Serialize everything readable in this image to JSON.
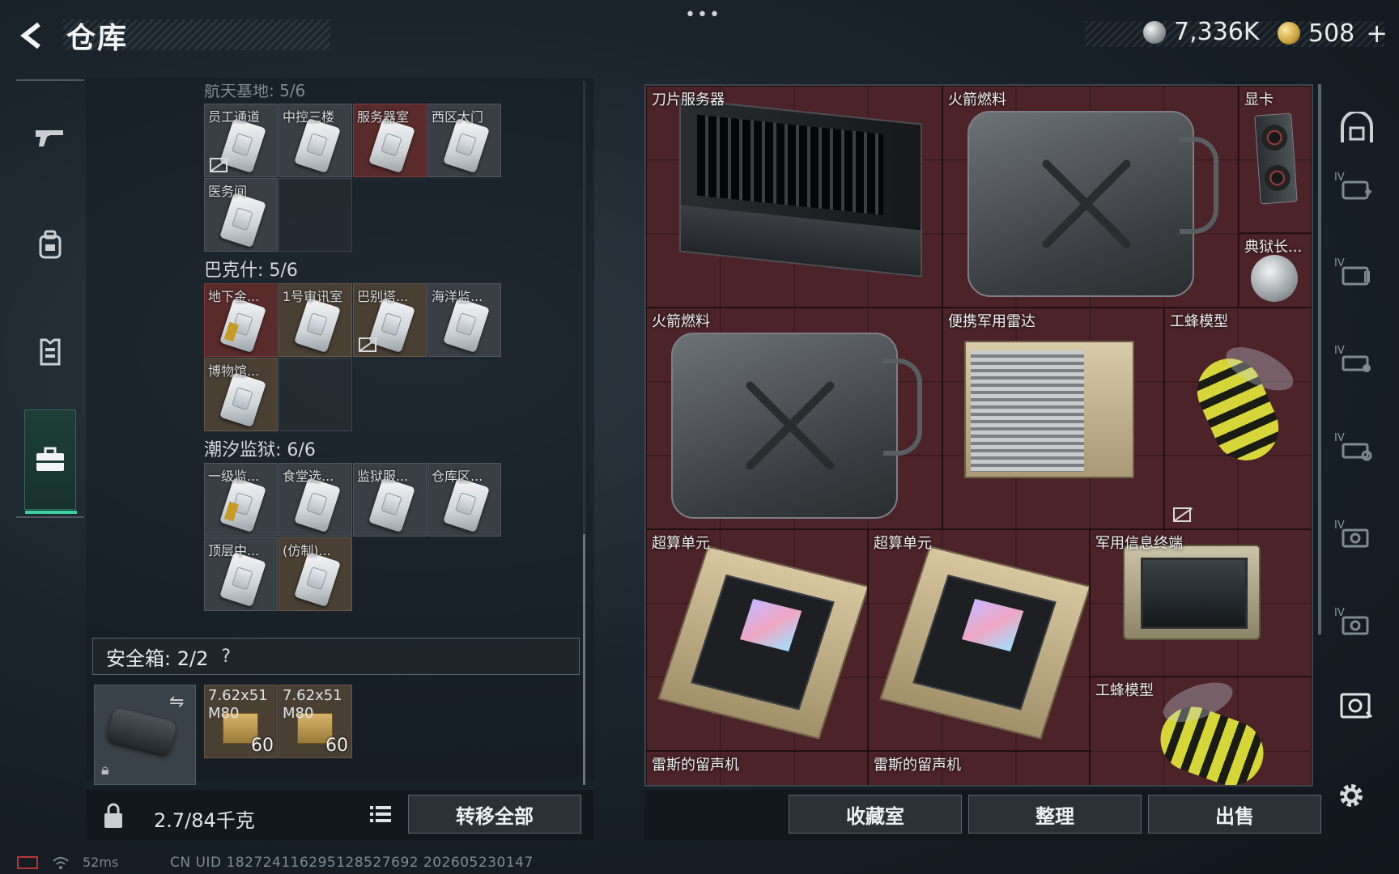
{
  "header": {
    "title": "仓库",
    "currency": [
      {
        "icon": "silver-coin-icon",
        "amount": "7,336K"
      },
      {
        "icon": "gold-coin-icon",
        "amount": "508",
        "add": "+"
      }
    ]
  },
  "left_tabs": [
    {
      "icon": "gun-icon"
    },
    {
      "icon": "backpack-icon"
    },
    {
      "icon": "vest-icon"
    },
    {
      "icon": "briefcase-icon",
      "active": true
    }
  ],
  "key_groups": [
    {
      "title": "航天基地: 5/6",
      "cards": [
        {
          "label": "员工通道",
          "tone": "grey",
          "locked": true
        },
        {
          "label": "中控三楼",
          "tone": "grey"
        },
        {
          "label": "服务器室",
          "tone": "red"
        },
        {
          "label": "西区大门",
          "tone": "grey"
        },
        {
          "label": "医务间",
          "tone": "grey"
        }
      ]
    },
    {
      "title": "巴克什: 5/6",
      "cards": [
        {
          "label": "地下金...",
          "tone": "red",
          "gold": true
        },
        {
          "label": "1号审讯室",
          "tone": "brown"
        },
        {
          "label": "巴别塔...",
          "tone": "brown",
          "locked": true
        },
        {
          "label": "海洋监...",
          "tone": "grey"
        },
        {
          "label": "博物馆...",
          "tone": "brown"
        }
      ]
    },
    {
      "title": "潮汐监狱: 6/6",
      "cards": [
        {
          "label": "一级监...",
          "tone": "grey",
          "gold": true
        },
        {
          "label": "食堂选...",
          "tone": "grey"
        },
        {
          "label": "监狱服...",
          "tone": "grey"
        },
        {
          "label": "仓库区...",
          "tone": "grey"
        },
        {
          "label": "顶层中...",
          "tone": "grey"
        },
        {
          "label": "(仿制)...",
          "tone": "brown"
        }
      ]
    }
  ],
  "safe_box": {
    "label": "安全箱: 2/2",
    "help": "?",
    "ammo": [
      {
        "name": "7.62x51 M80",
        "count": "60"
      },
      {
        "name": "7.62x51 M80",
        "count": "60"
      }
    ]
  },
  "weight": "2.7/84千克",
  "transfer_all": "转移全部",
  "inventory_items": [
    {
      "name": "刀片服务器"
    },
    {
      "name": "火箭燃料"
    },
    {
      "name": "显卡"
    },
    {
      "name": "典狱长..."
    },
    {
      "name": "火箭燃料"
    },
    {
      "name": "便携军用雷达"
    },
    {
      "name": "工蜂模型"
    },
    {
      "name": "超算单元"
    },
    {
      "name": "超算单元"
    },
    {
      "name": "军用信息终端"
    },
    {
      "name": "工蜂模型"
    },
    {
      "name": "雷斯的留声机"
    },
    {
      "name": "雷斯的留声机"
    }
  ],
  "actions": {
    "collection": "收藏室",
    "sort": "整理",
    "sell": "出售"
  },
  "right_tiers": [
    "IV",
    "IV",
    "IV",
    "IV",
    "IV",
    "IV"
  ],
  "status": {
    "ping": "52ms",
    "uid": "CN UID 182724116295128527692 202605230147"
  },
  "colors": {
    "accent": "#3ad29f",
    "item_bg": "#4b2329"
  }
}
